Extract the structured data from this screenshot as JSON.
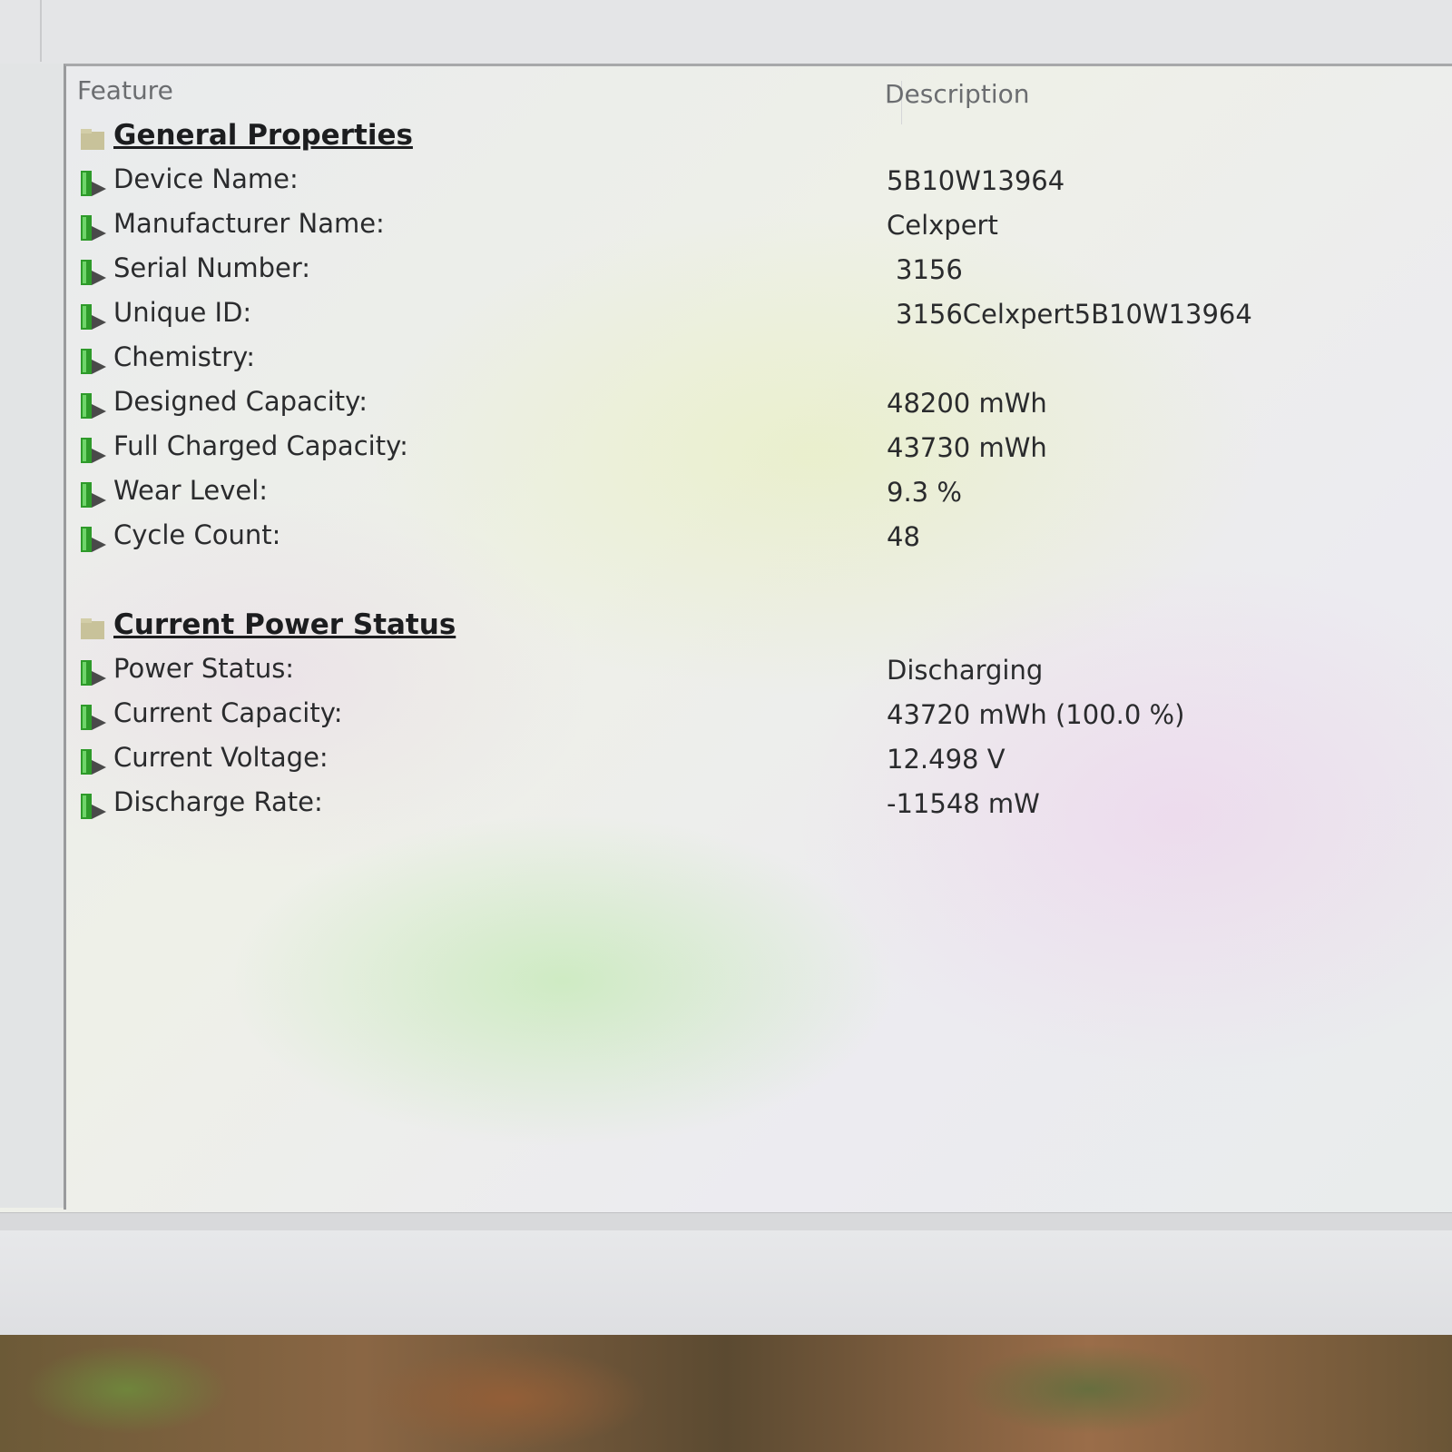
{
  "columns": {
    "feature": "Feature",
    "description": "Description"
  },
  "sections": [
    {
      "title": "General Properties",
      "rows": [
        {
          "label": "Device Name:",
          "value": "5B10W13964"
        },
        {
          "label": "Manufacturer Name:",
          "value": "Celxpert"
        },
        {
          "label": "Serial Number:",
          "value": "3156"
        },
        {
          "label": "Unique ID:",
          "value": "3156Celxpert5B10W13964"
        },
        {
          "label": "Chemistry:",
          "value": ""
        },
        {
          "label": "Designed Capacity:",
          "value": "48200 mWh"
        },
        {
          "label": "Full Charged Capacity:",
          "value": "43730 mWh"
        },
        {
          "label": "Wear Level:",
          "value": "9.3 %"
        },
        {
          "label": "Cycle Count:",
          "value": "48"
        }
      ]
    },
    {
      "title": "Current Power Status",
      "rows": [
        {
          "label": "Power Status:",
          "value": "Discharging"
        },
        {
          "label": "Current Capacity:",
          "value": "43720 mWh (100.0 %)"
        },
        {
          "label": "Current Voltage:",
          "value": "12.498 V"
        },
        {
          "label": "Discharge Rate:",
          "value": "-11548 mW"
        }
      ]
    }
  ],
  "icons": {
    "section": "section-folder-icon",
    "item": "battery-item-icon"
  },
  "colors": {
    "item_icon": "#2e9a2a",
    "section_icon": "#c8c29a"
  }
}
